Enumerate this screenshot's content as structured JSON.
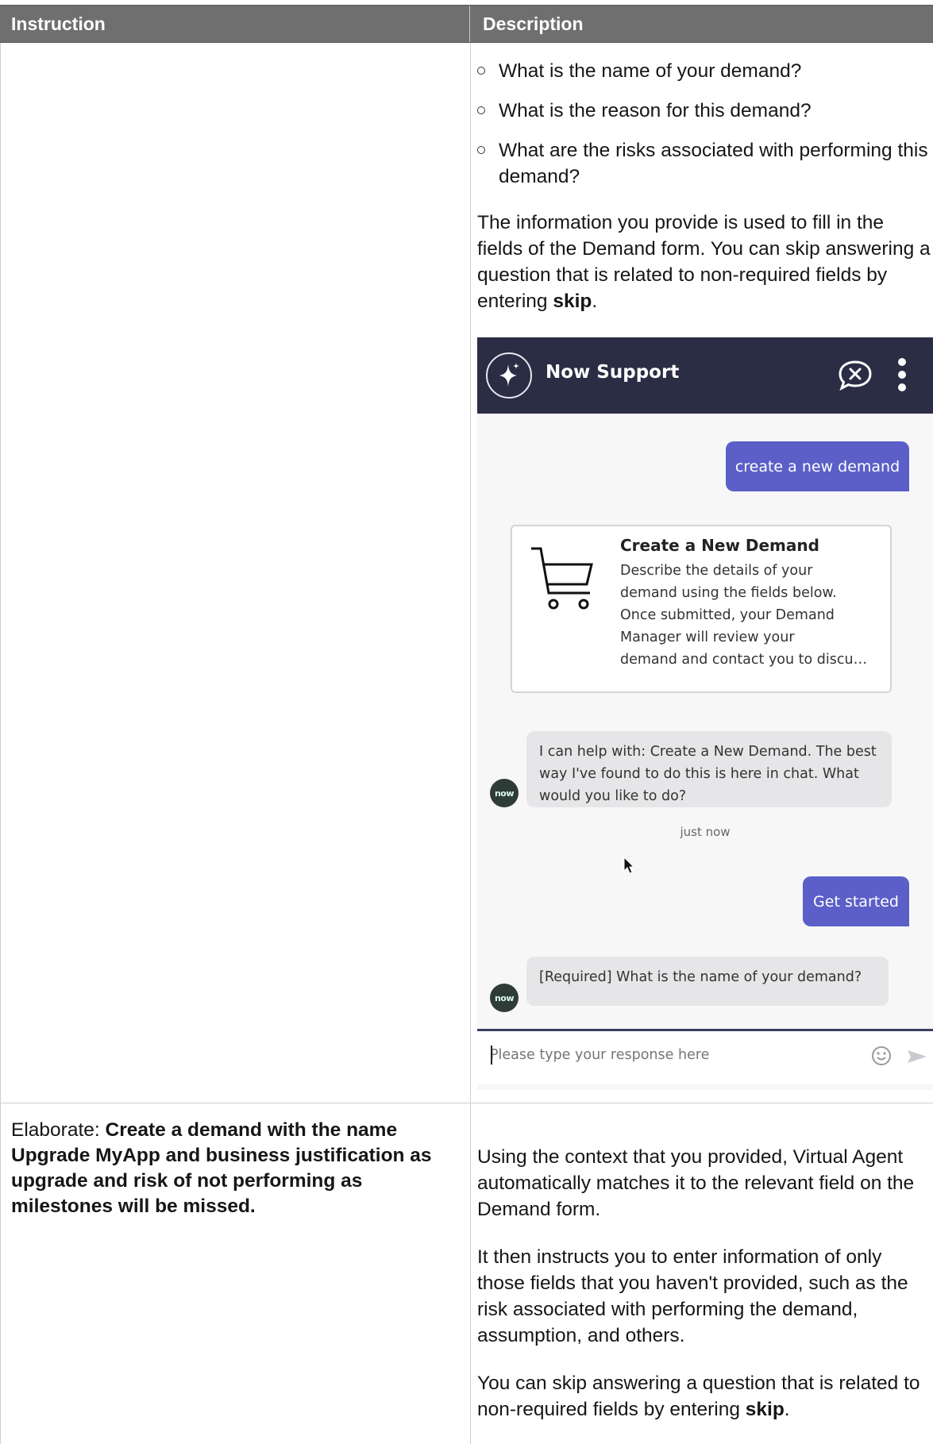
{
  "table": {
    "headers": [
      "Instruction",
      "Description"
    ]
  },
  "row1": {
    "bullets": [
      "What is the name of your demand?",
      "What is the reason for this demand?",
      "What are the risks associated with performing this demand?"
    ],
    "paragraph_pre": "The information you provide is used to fill in the fields of the Demand form. You can skip answering a question that is related to non-required fields by entering ",
    "paragraph_bold": "skip",
    "paragraph_post": ".",
    "chat": {
      "title": "Now Support",
      "icons": [
        "sparkle-logo-icon",
        "end-chat-icon",
        "more-vertical-icon",
        "cart-icon",
        "emoji-icon",
        "send-icon",
        "pointer-cursor-icon"
      ],
      "user_message_1": "create a new demand",
      "card_title": "Create a New Demand",
      "card_text": " Describe the details of your\ndemand using the fields below.\nOnce submitted, your Demand\nManager will review your\ndemand and contact you to discu…",
      "bot_message_1": "I can help with: Create a New Demand. The best way I've found to do this is here in chat. What would you like to do?",
      "timestamp": "just now",
      "user_message_2": "Get started",
      "bot_message_2": "[Required] What is the name of your demand?",
      "avatar_text": "now",
      "input_placeholder": "Please type your response here",
      "accent_color": "#5b5fc7",
      "header_color": "#2a2d44"
    }
  },
  "row2": {
    "instruction_prefix": "Elaborate: ",
    "instruction_bold": "Create a demand with the name Upgrade MyApp and business justification as upgrade and risk of not performing as milestones will be missed.",
    "para1": "Using the context that you provided, Virtual Agent automatically matches it to the relevant field on the Demand form.",
    "para2": "It then instructs you to enter information of only those fields that you haven't provided, such as the risk associated with performing the demand, assumption, and others.",
    "para3_pre": "You can skip answering a question that is related to non-required fields by entering ",
    "para3_bold": "skip",
    "para3_post": "."
  }
}
